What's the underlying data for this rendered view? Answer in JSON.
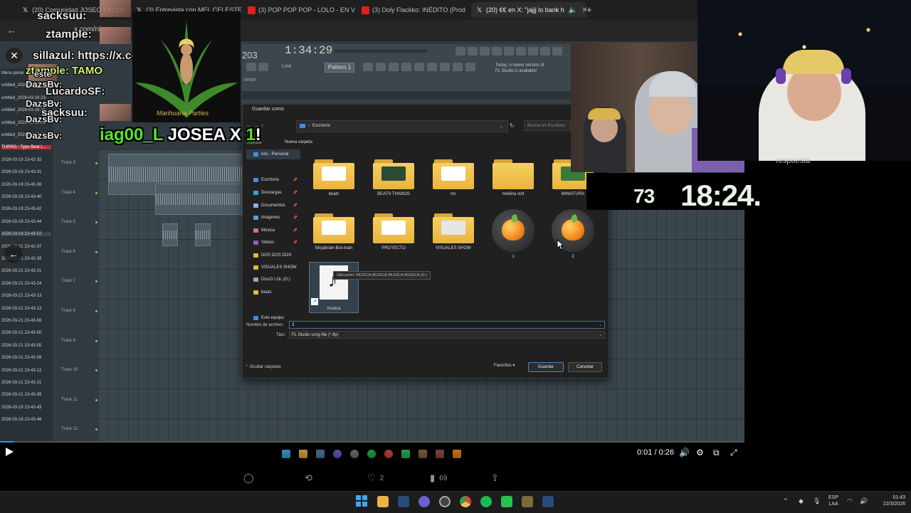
{
  "browser": {
    "tabs": [
      {
        "favicon": "x-icon",
        "label": "(20) Comunidad JOSEO EXCLU"
      },
      {
        "favicon": "x-icon",
        "label": "(3) Entrevista con MEL CELESTE"
      },
      {
        "favicon": "youtube-icon",
        "label": "(3) POP POP POP - LOLO - EN V"
      },
      {
        "favicon": "youtube-icon",
        "label": "(3) Doly Flackko: INÉDITO (Prod"
      },
      {
        "favicon": "x-icon",
        "label": "(20) €€ en X: \"jajjj lo bank h"
      }
    ],
    "new_tab": "+",
    "url": "x.com/ni"
  },
  "fl": {
    "time": "1:34:29",
    "bar_num": "203",
    "pattern": "Pattern 1",
    "line_mode": "Line",
    "newer_notice": "Today: A newer version of FL Studio is available!",
    "scale": "minor",
    "tracks": [
      "Track 3",
      "Track 4",
      "Track 5",
      "Track 6",
      "Track 7",
      "Track 8",
      "Track 9",
      "Track 10",
      "Track 11",
      "Track 12"
    ],
    "left_items": [
      "Menu panel",
      "untitled_2026-03-19 23-",
      "untitled_2026-03-19 23-",
      "untitled_2026-03-19 23-",
      "untitled_2026-03-19 23-",
      "untitled_2026-03-19 23-",
      "TURRO - Type Beat L...",
      "2026-03-19 23-42-32",
      "2026-03-19 23-43-31",
      "2026-03-19 23-43-36",
      "2026-03-19 23-43-40",
      "2026-03-19 23-43-42",
      "2026-03-19 23-43-44",
      "2026-03-19 23-43-52",
      "2026-03-21 23-42-37",
      "2026-03-21 23-42-39",
      "2026-03-21 23-43-21",
      "2026-03-21 23-43-24",
      "2026-03-21 23-43-13",
      "2026-03-21 23-43-13",
      "2026-03-21 23-43-56",
      "2026-03-21 23-43-00",
      "2026-03-21 23-43-05",
      "2026-03-21 23-43-09",
      "2026-03-21 23-43-12",
      "2026-03-21 23-43-21",
      "2026-03-21 23-43-39",
      "2026-03-19 23-43-43",
      "2026-03-19 23-43-48"
    ]
  },
  "dialog": {
    "title": "Guardar como",
    "path": [
      "Escritorio"
    ],
    "search_placeholder": "Buscar en Escritorio",
    "organize": "Organizar",
    "new_folder": "Nueva carpeta",
    "nav": [
      {
        "label": "lolo - Personal",
        "icon": "cloud-icon"
      },
      {
        "label": "Escritorio",
        "icon": "desktop-icon"
      },
      {
        "label": "Descargas",
        "icon": "download-icon"
      },
      {
        "label": "Documentos",
        "icon": "document-icon"
      },
      {
        "label": "Imágenes",
        "icon": "image-icon"
      },
      {
        "label": "Música",
        "icon": "music-icon"
      },
      {
        "label": "Videos",
        "icon": "video-icon"
      },
      {
        "label": "DOS DOS DOS",
        "icon": "folder-icon"
      },
      {
        "label": "VISUALES SHOW",
        "icon": "folder-icon"
      },
      {
        "label": "DiscO LOL (D:)",
        "icon": "drive-icon"
      },
      {
        "label": "beats",
        "icon": "folder-icon"
      },
      {
        "label": "Este equipo",
        "icon": "pc-icon"
      }
    ],
    "files": [
      {
        "label": "beats",
        "kind": "folder"
      },
      {
        "label": "BEATS THANOS",
        "kind": "folder"
      },
      {
        "label": "mc",
        "kind": "folder"
      },
      {
        "label": "medina vlof",
        "kind": "folder"
      },
      {
        "label": "MINIATURA",
        "kind": "folder"
      },
      {
        "label": "Ninjabrain-Bot-main",
        "kind": "folder"
      },
      {
        "label": "PROYECTO",
        "kind": "folder"
      },
      {
        "label": "VISUALES SHOW",
        "kind": "folder"
      },
      {
        "label": "1",
        "kind": "flp"
      },
      {
        "label": "2",
        "kind": "flp"
      },
      {
        "label": "musica",
        "kind": "shortcut"
      }
    ],
    "tooltip": "Ubicación: MUSICA MUSICA MUSICA MUSICA (D:)",
    "filename_label": "Nombre de archivo:",
    "filename_value": "3",
    "type_label": "Tipo:",
    "type_value": "FL Studio song file (*.flp)",
    "hide_folders": "Ocultar carpetas",
    "favorites": "Favoritos",
    "save": "Guardar",
    "cancel": "Cancelar"
  },
  "overlay": {
    "chat": [
      {
        "text": "sacksuu:",
        "color": "#e8e8e8"
      },
      {
        "text": "ztample:",
        "color": "#e8e8e8"
      },
      {
        "text": "sillazul: https://x.com",
        "color": "#e8e8e8"
      },
      {
        "text": "ztample: TAMO",
        "color": "#d6f07a"
      },
      {
        "text": "este",
        "color": "#e8e8e8"
      },
      {
        "text": "DazsBv:",
        "color": "#e8e8e8"
      },
      {
        "text": "LucardoSF:",
        "color": "#e8e8e8"
      },
      {
        "text": "DazsBv:",
        "color": "#e8e8e8"
      },
      {
        "text": "sacksuu:",
        "color": "#e8e8e8"
      },
      {
        "text": "DazsBv:",
        "color": "#e8e8e8"
      },
      {
        "text": "DazsBv:",
        "color": "#e8e8e8"
      }
    ],
    "sub_user": "iag00_L",
    "sub_text": " JOSEA X ",
    "sub_num": "1",
    "sub_end": "!",
    "weed_caption": "Marihuana Parties",
    "resp": "respuesta",
    "timer_main": "18:24.",
    "timer_ms": "73"
  },
  "video": {
    "time": "0:01 / 0:26"
  },
  "tweet": {
    "likes": "2",
    "views": "69"
  },
  "taskbar": {
    "lang1": "ESP",
    "lang2": "LAA",
    "time": "01:43",
    "date": "22/3/2026"
  },
  "colors": {
    "accent": "#1d9bf0",
    "sub_green": "#59e02e",
    "folder": "#f2c14e"
  }
}
